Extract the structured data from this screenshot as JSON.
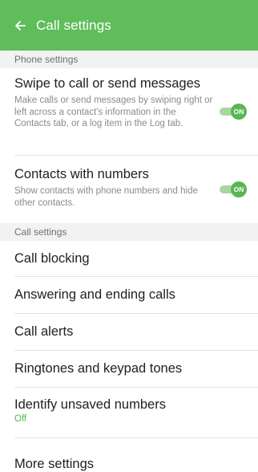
{
  "appbar": {
    "title": "Call settings"
  },
  "sections": {
    "phone_settings": "Phone settings",
    "call_settings": "Call settings"
  },
  "phone_settings": {
    "swipe": {
      "title": "Swipe to call or send messages",
      "desc": "Make calls or send messages by swiping right or left across a contact's information in the Contacts tab, or a log item in the Log tab.",
      "toggle": "ON"
    },
    "contacts_numbers": {
      "title": "Contacts with numbers",
      "desc": "Show contacts with phone numbers and hide other contacts.",
      "toggle": "ON"
    }
  },
  "call_settings": {
    "items": [
      {
        "label": "Call blocking"
      },
      {
        "label": "Answering and ending calls"
      },
      {
        "label": "Call alerts"
      },
      {
        "label": "Ringtones and keypad tones"
      },
      {
        "label": "Identify unsaved numbers",
        "value": "Off"
      },
      {
        "label": "More settings"
      }
    ]
  },
  "colors": {
    "accent": "#5fbd5a",
    "section_bg": "#f2f2f2"
  }
}
